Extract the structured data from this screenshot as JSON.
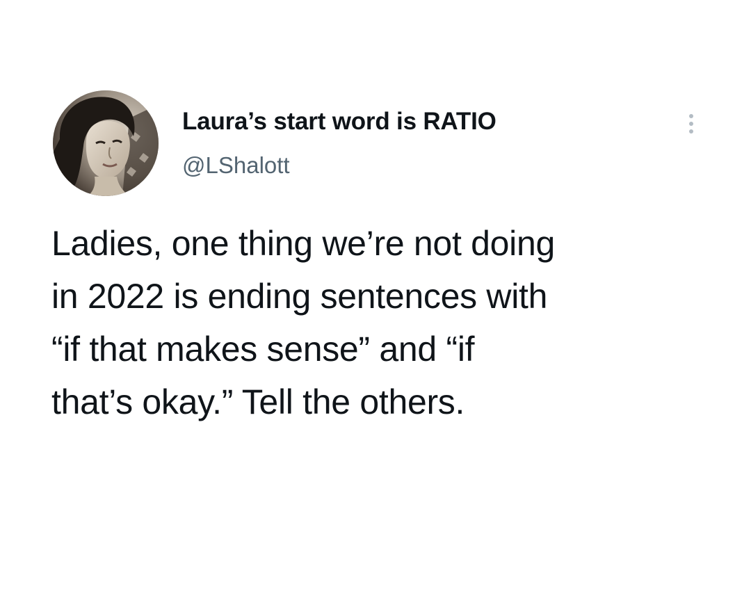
{
  "tweet": {
    "author": {
      "display_name": "Laura’s start word is RATIO",
      "handle": "@LShalott",
      "avatar": "profile-photo"
    },
    "more_icon": "more-vertical-icon",
    "text_lines": [
      "Ladies, one thing we’re not doing",
      "in 2022 is ending sentences with",
      "“if that makes sense” and “if",
      "that’s okay.” Tell the others."
    ]
  },
  "colors": {
    "text": "#0f1419",
    "secondary_text": "#536471",
    "background": "#ffffff"
  }
}
